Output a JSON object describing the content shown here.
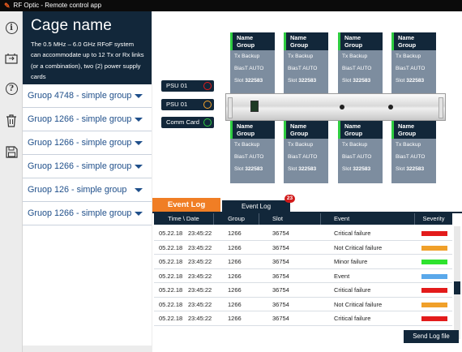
{
  "app": {
    "title": "RF Optic - Remote control app"
  },
  "toolbar": {
    "icons": [
      "info-icon",
      "switch-icon",
      "help-icon",
      "trash-icon",
      "save-icon"
    ],
    "help_glyph": "?",
    "info_glyph": "i"
  },
  "cage": {
    "title": "Cage name",
    "description": "The 0.5 MHz – 6.0 GHz RFoF system can accommodate up to 12 Tx or Rx links (or a combination), two (2) power supply cards"
  },
  "groups": [
    {
      "label": "Gruop 4748 - simple group"
    },
    {
      "label": "Gruop 1266 - simple group"
    },
    {
      "label": "Gruop 1266 - simple group"
    },
    {
      "label": "Gruop 1266 - simple group"
    },
    {
      "label": "Gruop 126 - simple group"
    },
    {
      "label": "Gruop 1266 - simple group"
    }
  ],
  "psu": [
    {
      "label": "PSU 01",
      "color": "#e31b1b"
    },
    {
      "label": "PSU 01",
      "color": "#f0a02a"
    },
    {
      "label": "Comm Card",
      "color": "#2ecc40"
    }
  ],
  "cards": {
    "top": [
      {
        "name": "Name",
        "group": "Group",
        "line1": "Tx Backup",
        "line2": "BiasT AUTO",
        "slot_label": "Slot",
        "slot": "322583"
      },
      {
        "name": "Name",
        "group": "Group",
        "line1": "Tx Backup",
        "line2": "BiasT AUTO",
        "slot_label": "Slot",
        "slot": "322583"
      },
      {
        "name": "Name",
        "group": "Group",
        "line1": "Tx Backup",
        "line2": "BiasT AUTO",
        "slot_label": "Slot",
        "slot": "322583"
      },
      {
        "name": "Name",
        "group": "Group",
        "line1": "Tx Backup",
        "line2": "BiasT AUTO",
        "slot_label": "Slot",
        "slot": "322583"
      }
    ],
    "bottom": [
      {
        "name": "Name",
        "group": "Group",
        "line1": "Tx Backup",
        "line2": "BiasT AUTO",
        "slot_label": "Slot",
        "slot": "322583"
      },
      {
        "name": "Name",
        "group": "Group",
        "line1": "Tx Backup",
        "line2": "BiasT AUTO",
        "slot_label": "Slot",
        "slot": "322583"
      },
      {
        "name": "Name",
        "group": "Group",
        "line1": "Tx Backup",
        "line2": "BiasT AUTO",
        "slot_label": "Slot",
        "slot": "322583"
      },
      {
        "name": "Name",
        "group": "Group",
        "line1": "Tx Backup",
        "line2": "BiasT AUTO",
        "slot_label": "Slot",
        "slot": "322583"
      }
    ]
  },
  "log": {
    "tab_active": "Event Log",
    "tab_inactive": "Event Log",
    "badge": "23",
    "columns": [
      "Time \\ Date",
      "Group",
      "Slot",
      "Event",
      "Severity"
    ],
    "rows": [
      {
        "date": "05.22.18",
        "time": "23:45:22",
        "group": "1266",
        "slot": "36754",
        "event": "Critical failure",
        "severity": "#e31b1b"
      },
      {
        "date": "05.22.18",
        "time": "23:45:22",
        "group": "1266",
        "slot": "36754",
        "event": "Not Critical failure",
        "severity": "#f0a02a"
      },
      {
        "date": "05.22.18",
        "time": "23:45:22",
        "group": "1266",
        "slot": "36754",
        "event": "Minor failure",
        "severity": "#2ee32e"
      },
      {
        "date": "05.22.18",
        "time": "23:45:22",
        "group": "1266",
        "slot": "36754",
        "event": "Event",
        "severity": "#5aa8ea"
      },
      {
        "date": "05.22.18",
        "time": "23:45:22",
        "group": "1266",
        "slot": "36754",
        "event": "Critical failure",
        "severity": "#e31b1b"
      },
      {
        "date": "05.22.18",
        "time": "23:45:22",
        "group": "1266",
        "slot": "36754",
        "event": "Not Critical failure",
        "severity": "#f0a02a"
      },
      {
        "date": "05.22.18",
        "time": "23:45:22",
        "group": "1266",
        "slot": "36754",
        "event": "Critical failure",
        "severity": "#e31b1b"
      }
    ],
    "send_label": "Send Log file"
  }
}
